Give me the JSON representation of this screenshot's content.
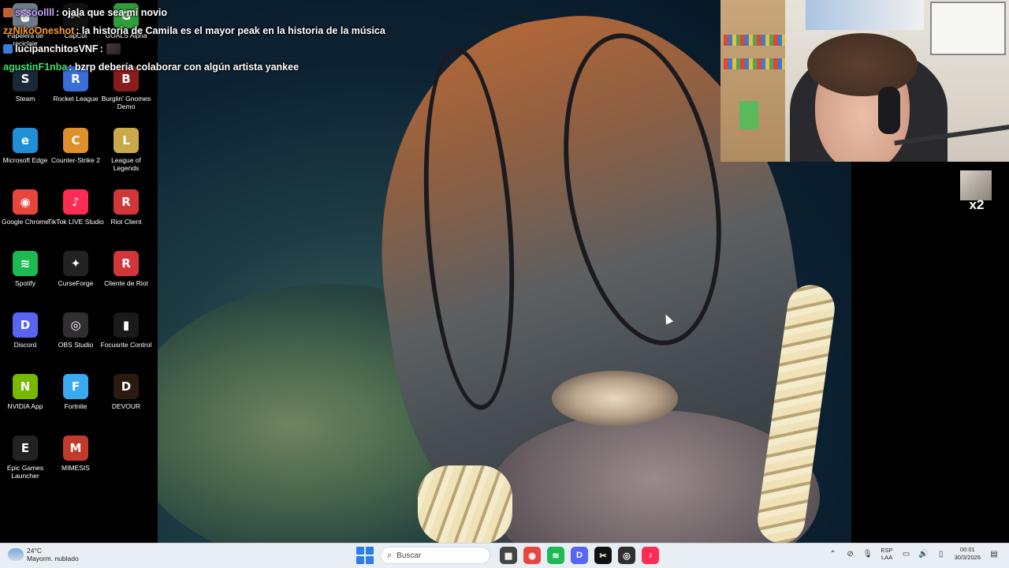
{
  "desktop": {
    "icons": [
      {
        "label": "Papelera de reciclaje",
        "glyph": "🗑",
        "color": "#6c7a89"
      },
      {
        "label": "CapCut",
        "glyph": "✂",
        "color": "#111111"
      },
      {
        "label": "GOALS Alpha",
        "glyph": "G",
        "color": "#2f9e3a"
      },
      {
        "label": "Steam",
        "glyph": "S",
        "color": "#1b2838"
      },
      {
        "label": "Rocket League",
        "glyph": "R",
        "color": "#3b6fd8"
      },
      {
        "label": "Burglin' Gnomes Demo",
        "glyph": "B",
        "color": "#8a1c1c"
      },
      {
        "label": "Microsoft Edge",
        "glyph": "e",
        "color": "#1f8fd8"
      },
      {
        "label": "Counter-Strike 2",
        "glyph": "C",
        "color": "#e0902a"
      },
      {
        "label": "League of Legends",
        "glyph": "L",
        "color": "#c9a94a"
      },
      {
        "label": "Google Chrome",
        "glyph": "◉",
        "color": "#e8453c"
      },
      {
        "label": "TikTok LIVE Studio",
        "glyph": "♪",
        "color": "#fe2c55"
      },
      {
        "label": "Riot Client",
        "glyph": "R",
        "color": "#d13639"
      },
      {
        "label": "Spotify",
        "glyph": "≋",
        "color": "#1db954"
      },
      {
        "label": "CurseForge",
        "glyph": "✦",
        "color": "#222222"
      },
      {
        "label": "Cliente de Riot",
        "glyph": "R",
        "color": "#d13639"
      },
      {
        "label": "Discord",
        "glyph": "D",
        "color": "#5865f2"
      },
      {
        "label": "OBS Studio",
        "glyph": "◎",
        "color": "#302e31"
      },
      {
        "label": "Focusrite Control",
        "glyph": "▮",
        "color": "#1a1a1a"
      },
      {
        "label": "NVIDIA App",
        "glyph": "N",
        "color": "#76b900"
      },
      {
        "label": "Fortnite",
        "glyph": "F",
        "color": "#3aa9f0"
      },
      {
        "label": "DEVOUR",
        "glyph": "D",
        "color": "#2a1a10"
      },
      {
        "label": "Epic Games Launcher",
        "glyph": "E",
        "color": "#222222"
      },
      {
        "label": "MIMESIS",
        "glyph": "M",
        "color": "#c23a2a"
      }
    ]
  },
  "chat": [
    {
      "user": "sssoollll",
      "user_color": "#c9a0ff",
      "message": ": ojala que sea mi novio",
      "emote": false
    },
    {
      "user": "zzNikoOneshot",
      "user_color": "#ff9a2e",
      "message": ": la historia de Camila es el mayor peak en la historia de la música",
      "emote": false
    },
    {
      "user": "lucipanchitosVNF",
      "user_color": "#ffffff",
      "message": ":",
      "emote": true
    },
    {
      "user": "agustinF1nba",
      "user_color": "#3ee06b",
      "message": ": bzrp debería colaborar con algún artista yankee",
      "emote": false
    }
  ],
  "overlay": {
    "multiplier": "x2"
  },
  "taskbar": {
    "weather_temp": "24°C",
    "weather_desc": "Mayorm. nublado",
    "search_placeholder": "Buscar",
    "lang_top": "ESP",
    "lang_bottom": "LAA",
    "time": "00:01",
    "date": "30/3/2026",
    "apps": [
      {
        "name": "file-explorer",
        "glyph": "▦",
        "color": "#444444"
      },
      {
        "name": "chrome",
        "glyph": "◉",
        "color": "#e8453c"
      },
      {
        "name": "spotify",
        "glyph": "≋",
        "color": "#1db954"
      },
      {
        "name": "discord",
        "glyph": "D",
        "color": "#5865f2"
      },
      {
        "name": "capcut",
        "glyph": "✂",
        "color": "#111111"
      },
      {
        "name": "obs",
        "glyph": "◎",
        "color": "#302e31"
      },
      {
        "name": "tiktok-live",
        "glyph": "♪",
        "color": "#fe2c55"
      }
    ]
  }
}
